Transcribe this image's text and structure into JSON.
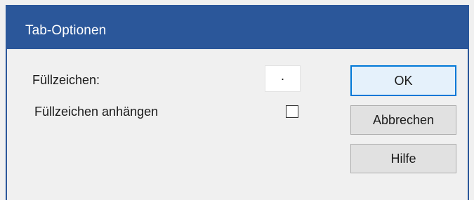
{
  "dialog": {
    "title": "Tab-Optionen"
  },
  "fields": {
    "fill_char_label": "Füllzeichen:",
    "fill_char_value": ".",
    "append_label": "Füllzeichen anhängen",
    "append_checked": false
  },
  "buttons": {
    "ok_label": "OK",
    "cancel_label": "Abbrechen",
    "help_label": "Hilfe"
  },
  "colors": {
    "titlebar": "#2b579a",
    "dialog_background": "#f0f0f0",
    "default_button_border": "#0078d7"
  }
}
